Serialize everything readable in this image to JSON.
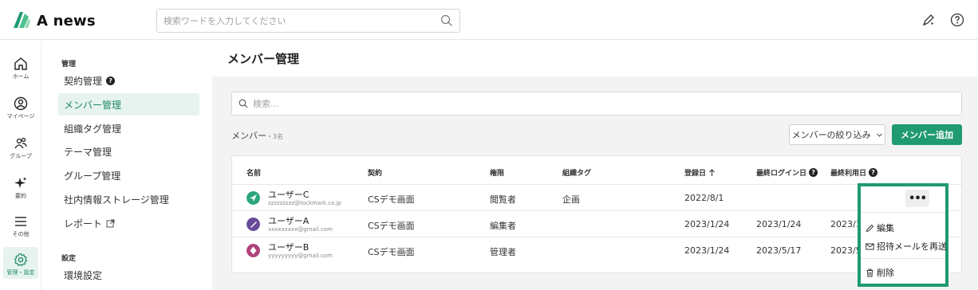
{
  "header": {
    "logo_text": "A news",
    "search_placeholder": "検索ワードを入力してください"
  },
  "rail": [
    {
      "label": "ホーム",
      "icon": "home-icon"
    },
    {
      "label": "マイページ",
      "icon": "user-circle-icon"
    },
    {
      "label": "グループ",
      "icon": "group-icon"
    },
    {
      "label": "要約",
      "icon": "sparkle-icon"
    },
    {
      "label": "その他",
      "icon": "menu-icon"
    },
    {
      "label": "管理・設定",
      "icon": "gear-icon",
      "active": true
    }
  ],
  "sidebar": {
    "section1": "管理",
    "items": [
      {
        "label": "契約管理"
      },
      {
        "label": "メンバー管理",
        "active": true
      },
      {
        "label": "組織タグ管理"
      },
      {
        "label": "テーマ管理"
      },
      {
        "label": "グループ管理"
      },
      {
        "label": "社内情報ストレージ管理"
      },
      {
        "label": "レポート"
      }
    ],
    "section2": "設定",
    "settings_items": [
      {
        "label": "環境設定"
      }
    ]
  },
  "main": {
    "title": "メンバー管理",
    "search_placeholder": "検索...",
    "members_label": "メンバー",
    "members_count": "・3名",
    "filter_label": "メンバーの絞り込み",
    "add_label": "メンバー追加",
    "columns": {
      "name": "名前",
      "contract": "契約",
      "role": "権限",
      "tag": "組織タグ",
      "registered": "登録日",
      "last_login": "最終ログイン日",
      "last_use": "最終利用日"
    },
    "rows": [
      {
        "name": "ユーザーC",
        "email": "zzzzzzzzz@tockmark.co.jp",
        "contract": "CSデモ画面",
        "role": "閲覧者",
        "tag": "企画",
        "registered": "2022/8/1",
        "last_login": "",
        "last_use": "",
        "avatar_color": "#2aa67c"
      },
      {
        "name": "ユーザーA",
        "email": "xxxxxxxxx@gmail.com",
        "contract": "CSデモ画面",
        "role": "編集者",
        "tag": "",
        "registered": "2023/1/24",
        "last_login": "2023/1/24",
        "last_use": "2023/1",
        "avatar_color": "#6a4a9a"
      },
      {
        "name": "ユーザーB",
        "email": "yyyyyyyyy@gmail.com",
        "contract": "CSデモ画面",
        "role": "管理者",
        "tag": "",
        "registered": "2023/1/24",
        "last_login": "2023/5/17",
        "last_use": "2023/5",
        "avatar_color": "#b0437a"
      }
    ]
  },
  "menu": {
    "more": "•••",
    "edit": "編集",
    "resend": "招待メールを再送",
    "delete": "削除"
  },
  "colors": {
    "accent": "#1f9a72",
    "active_bg": "#e6f3ee"
  }
}
